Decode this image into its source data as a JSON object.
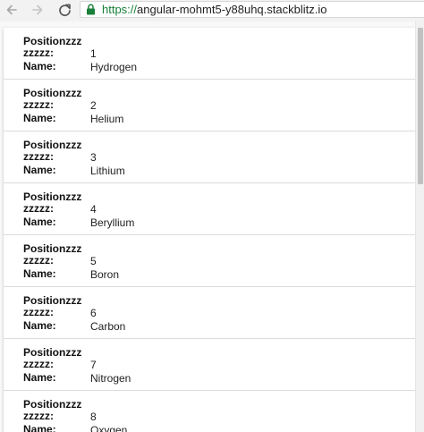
{
  "browser": {
    "url_scheme": "https://",
    "url_host": "angular-mohmt5-y88uhq.stackblitz.io"
  },
  "list": {
    "label_position": "Positionzzz",
    "label_position_cont": "zzzzz:",
    "label_name": "Name:",
    "items": [
      {
        "position": "1",
        "name": "Hydrogen"
      },
      {
        "position": "2",
        "name": "Helium"
      },
      {
        "position": "3",
        "name": "Lithium"
      },
      {
        "position": "4",
        "name": "Beryllium"
      },
      {
        "position": "5",
        "name": "Boron"
      },
      {
        "position": "6",
        "name": "Carbon"
      },
      {
        "position": "7",
        "name": "Nitrogen"
      },
      {
        "position": "8",
        "name": "Oxygen"
      }
    ]
  }
}
